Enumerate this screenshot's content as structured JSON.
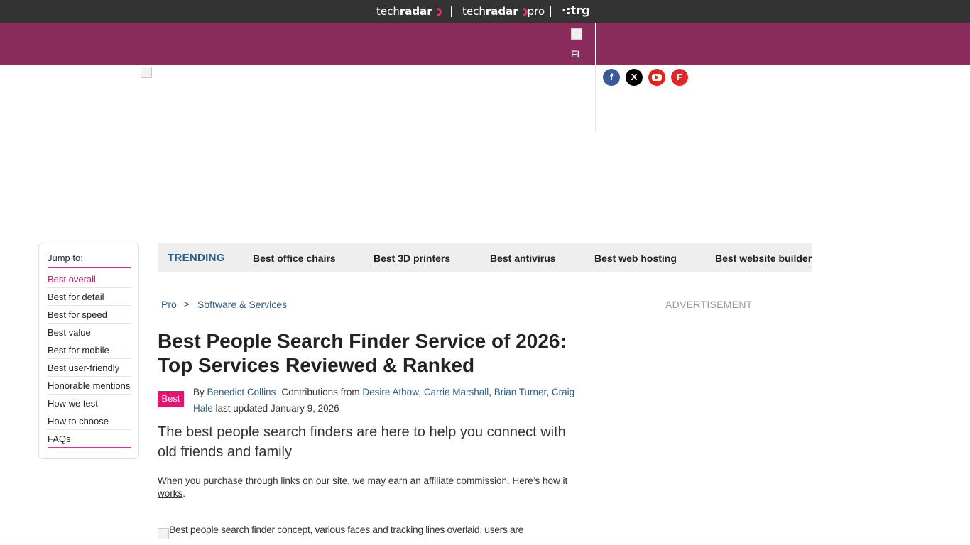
{
  "brands": {
    "techradar": {
      "prefix": "tech",
      "accent": "radar"
    },
    "techradar_pro": {
      "prefix": "tech",
      "accent": "radar",
      "suffix": "pro"
    },
    "trg": "·:trg"
  },
  "header": {
    "logo_alt": "FL",
    "bar_color": "#8a2d5c",
    "top_bar_color": "#333333"
  },
  "social": [
    {
      "name": "facebook",
      "glyph": "f"
    },
    {
      "name": "x",
      "glyph": "X"
    },
    {
      "name": "youtube",
      "glyph": ""
    },
    {
      "name": "flipboard",
      "glyph": "F"
    }
  ],
  "jump_to": {
    "title": "Jump to:",
    "items": [
      "Best overall",
      "Best for detail",
      "Best for speed",
      "Best value",
      "Best for mobile",
      "Best user-friendly",
      "Honorable mentions",
      "How we test",
      "How to choose",
      "FAQs"
    ],
    "active_index": 0,
    "accent_color": "#e0156e"
  },
  "trending": {
    "label": "TRENDING",
    "items": [
      "Best office chairs",
      "Best 3D printers",
      "Best antivirus",
      "Best web hosting",
      "Best website builder"
    ]
  },
  "breadcrumb": {
    "items": [
      "Pro",
      "Software & Services"
    ],
    "separator": ">"
  },
  "advertisement_label": "ADVERTISEMENT",
  "article": {
    "headline": "Best People Search Finder Service of 2026: Top Services Reviewed & Ranked",
    "badge": "Best",
    "byline": {
      "by": "By",
      "author": "Benedict Collins",
      "contributions_label": "Contributions from",
      "contributors": [
        "Desire Athow",
        "Carrie Marshall",
        "Brian Turner",
        "Craig Hale"
      ],
      "updated_label": "last updated",
      "updated_date": "January 9, 2026"
    },
    "standfirst": "The best people search finders are here to help you connect with old friends and family",
    "affiliate_text": "When you purchase through links on our site, we may earn an affiliate commission.",
    "affiliate_link": "Here’s how it works",
    "affiliate_end": ".",
    "image_alt": "Best people search finder concept, various faces and tracking lines overlaid, users are"
  }
}
